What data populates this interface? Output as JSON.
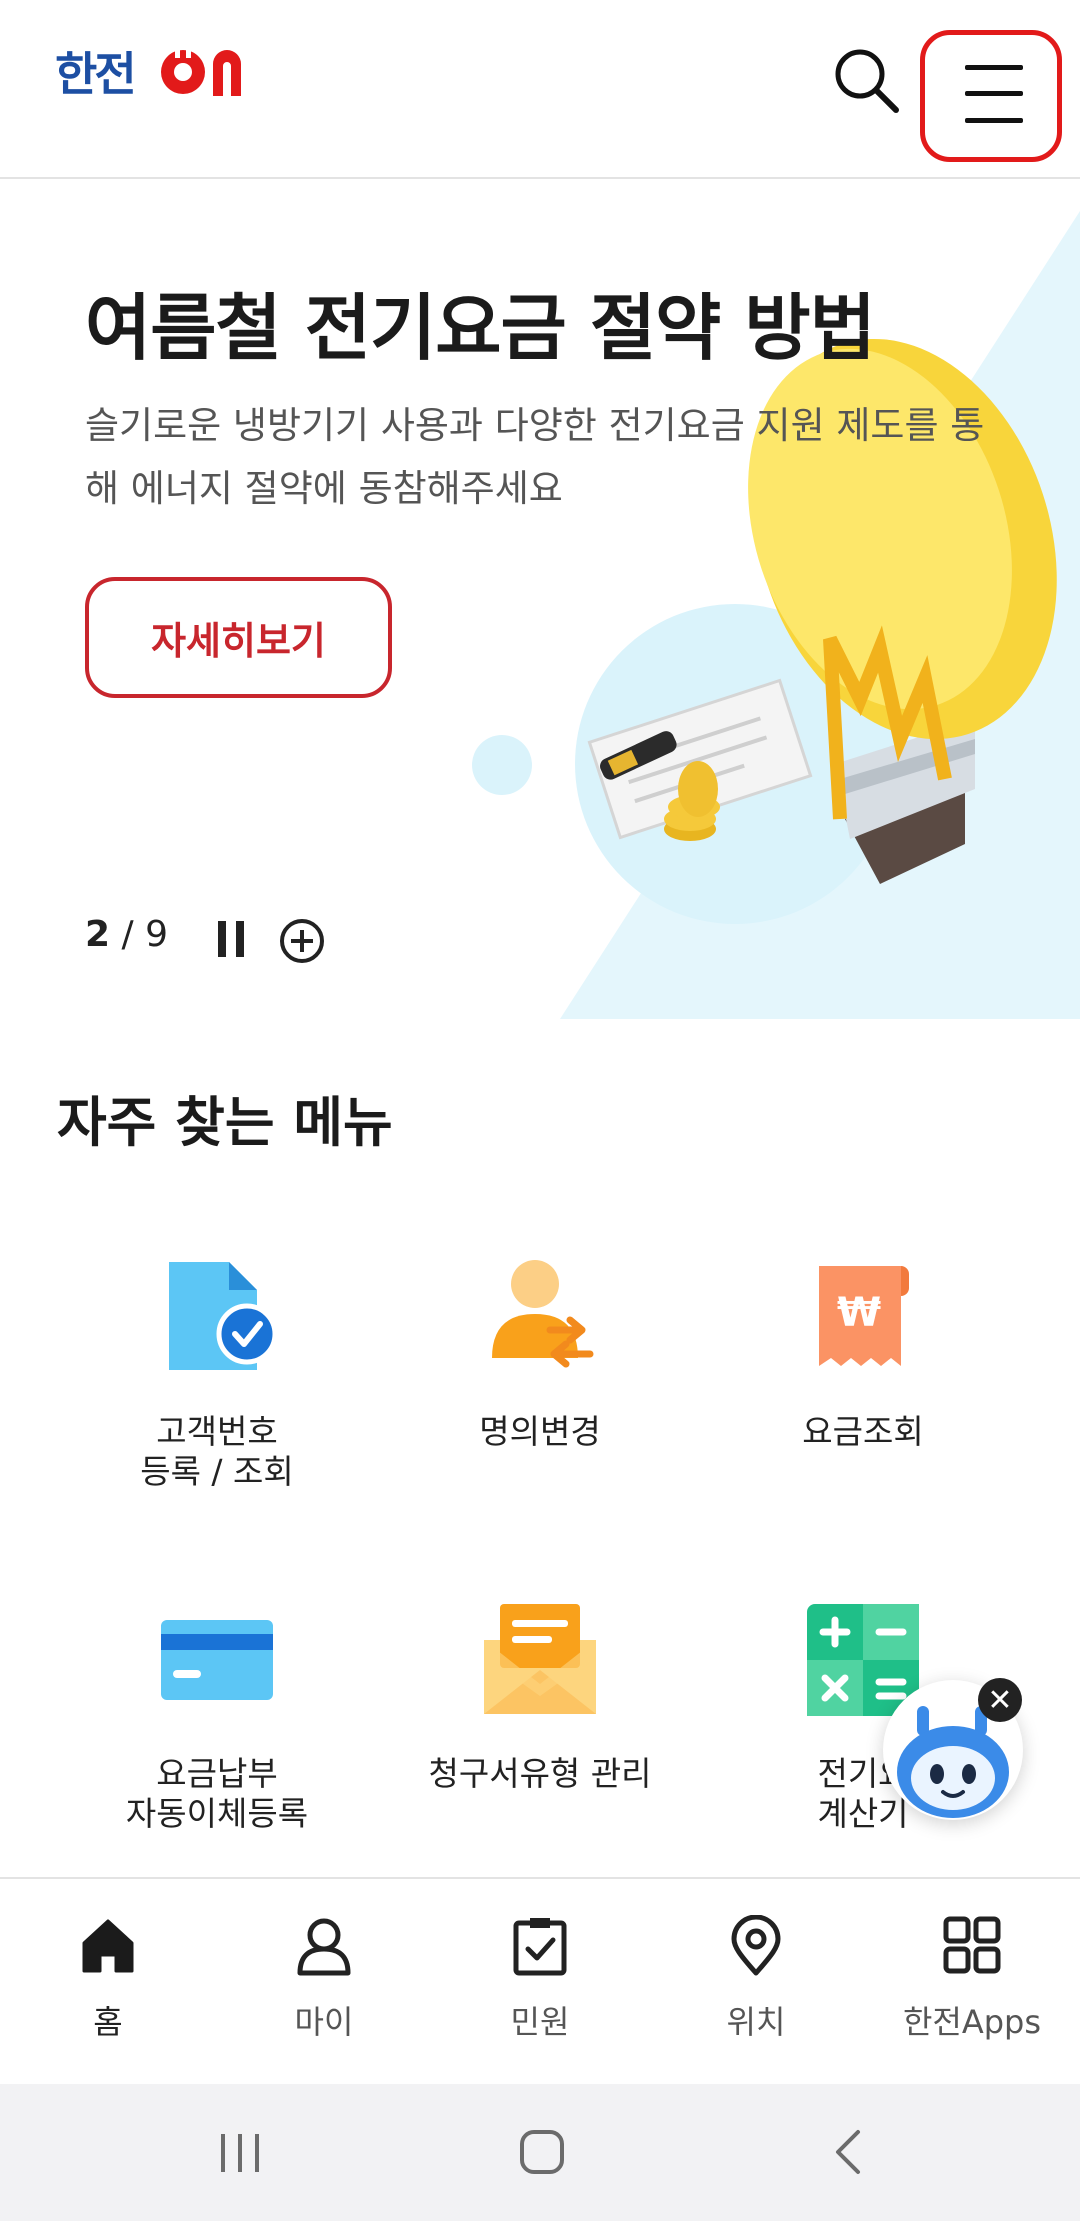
{
  "header": {
    "logo_text": "한전ON",
    "search_label": "검색",
    "menu_label": "전체메뉴"
  },
  "banner": {
    "title": "여름철 전기요금 절약 방법",
    "description": "슬기로운 냉방기기 사용과 다양한 전기요금 지원 제도를 통해 에너지 절약에 동참해주세요",
    "detail_button": "자세히보기",
    "counter_current": "2",
    "counter_separator": " / ",
    "counter_total": "9"
  },
  "frequent": {
    "title": "자주 찾는 메뉴",
    "items": [
      {
        "label": "고객번호\n등록 / 조회",
        "icon": "document-check-icon"
      },
      {
        "label": "명의변경",
        "icon": "person-transfer-icon"
      },
      {
        "label": "요금조회",
        "icon": "won-receipt-icon"
      },
      {
        "label": "요금납부\n자동이체등록",
        "icon": "credit-card-icon"
      },
      {
        "label": "청구서유형 관리",
        "icon": "envelope-icon"
      },
      {
        "label": "전기요\n계산기",
        "icon": "calculator-icon"
      }
    ]
  },
  "bottom_nav": {
    "items": [
      {
        "label": "홈",
        "icon": "home-icon"
      },
      {
        "label": "마이",
        "icon": "person-icon"
      },
      {
        "label": "민원",
        "icon": "clipboard-check-icon"
      },
      {
        "label": "위치",
        "icon": "location-pin-icon"
      },
      {
        "label": "한전Apps",
        "icon": "apps-grid-icon"
      }
    ]
  },
  "colors": {
    "brand_blue": "#1d4fa3",
    "brand_red": "#e21a1a",
    "button_red": "#c8262d"
  }
}
